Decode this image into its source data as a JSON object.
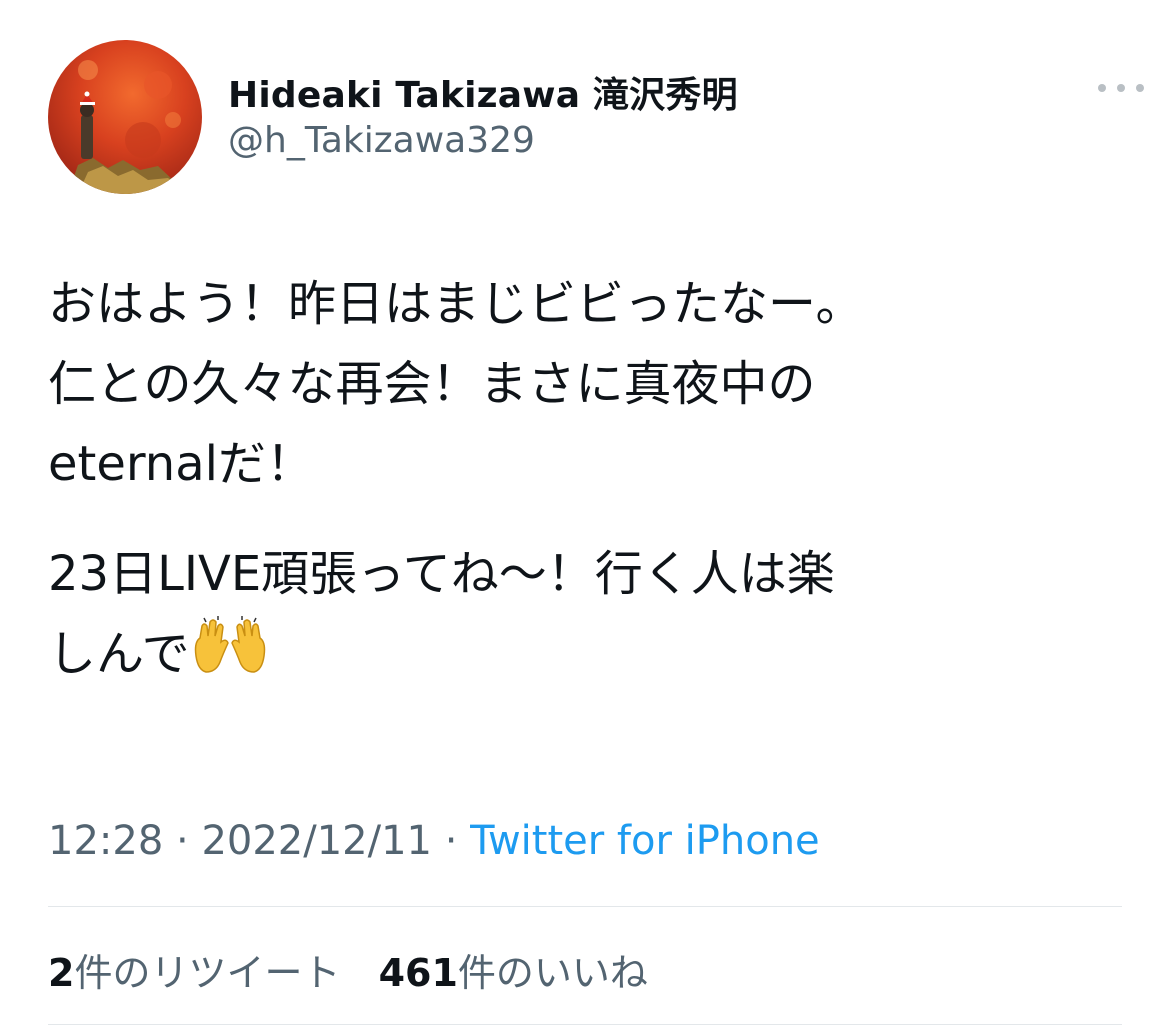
{
  "author": {
    "name": "Hideaki Takizawa 滝沢秀明",
    "handle": "@h_Takizawa329",
    "avatar_icon": "avatar-photo"
  },
  "more_icon": "more-horizontal-icon",
  "tweet": {
    "lines_para1": [
      "おはよう！昨日はまじビビったなー。",
      "仁との久々な再会！まさに真夜中の",
      "eternalだ！"
    ],
    "lines_para2": [
      "23日LIVE頑張ってね〜！行く人は楽",
      "しんで"
    ],
    "emoji": "raising-hands-icon"
  },
  "meta": {
    "time": "12:28",
    "separator": " · ",
    "date": "2022/12/11",
    "source": "Twitter for iPhone"
  },
  "stats": {
    "retweets_count": "2",
    "retweets_label": "件のリツイート",
    "likes_count": "461",
    "likes_label": "件のいいね"
  },
  "colors": {
    "text": "#0f1419",
    "secondary": "#536471",
    "link": "#1d9bf0",
    "divider": "#e3e7ea"
  }
}
